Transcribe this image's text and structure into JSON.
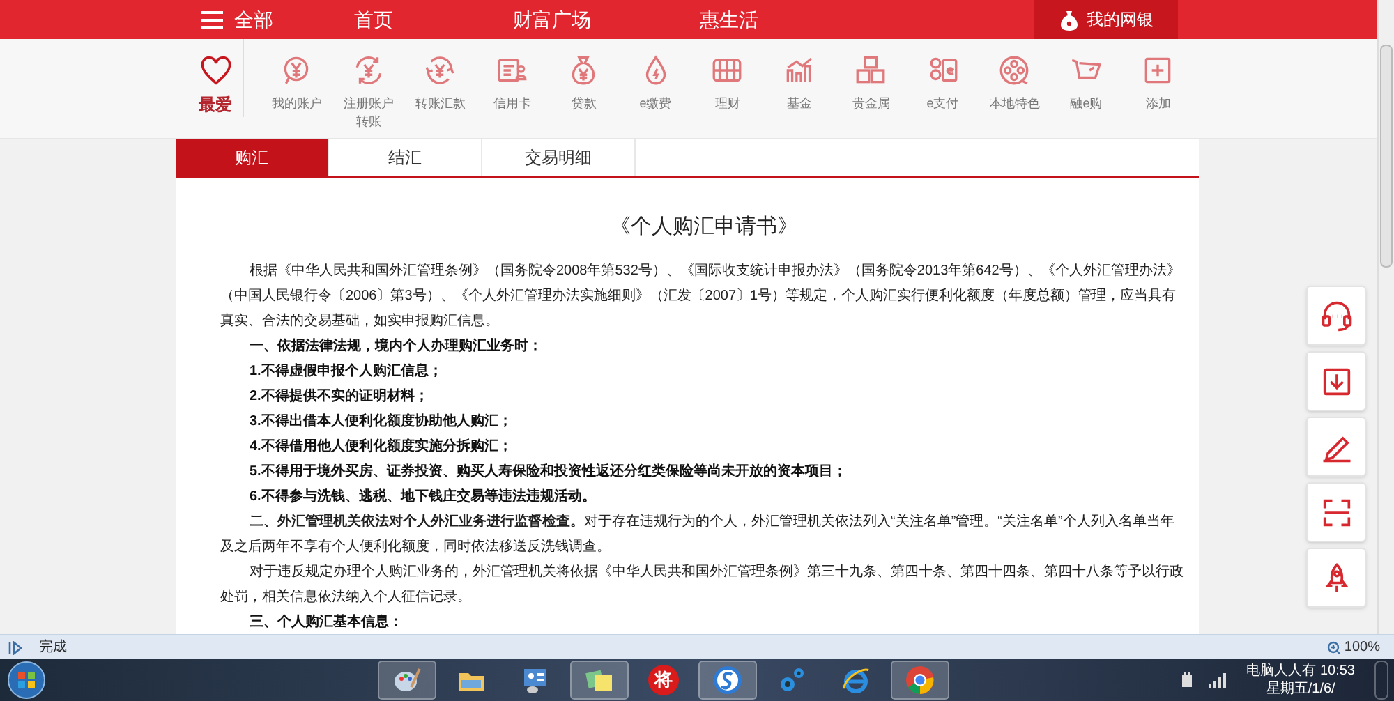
{
  "top_nav": {
    "menu_label": "全部",
    "items": [
      "首页",
      "财富广场",
      "惠生活"
    ],
    "account": "我的网银"
  },
  "shortcuts": [
    {
      "label": "最爱",
      "kind": "favorite"
    },
    {
      "label": "我的账户",
      "kind": "shortcut"
    },
    {
      "label": "注册账户转账",
      "kind": "shortcut"
    },
    {
      "label": "转账汇款",
      "kind": "shortcut"
    },
    {
      "label": "信用卡",
      "kind": "shortcut"
    },
    {
      "label": "贷款",
      "kind": "shortcut"
    },
    {
      "label": "e缴费",
      "kind": "shortcut"
    },
    {
      "label": "理财",
      "kind": "shortcut"
    },
    {
      "label": "基金",
      "kind": "shortcut"
    },
    {
      "label": "贵金属",
      "kind": "shortcut"
    },
    {
      "label": "e支付",
      "kind": "shortcut"
    },
    {
      "label": "本地特色",
      "kind": "shortcut"
    },
    {
      "label": "融e购",
      "kind": "shortcut"
    },
    {
      "label": "添加",
      "kind": "shortcut"
    }
  ],
  "tabs": [
    {
      "label": "购汇",
      "selected": true
    },
    {
      "label": "结汇",
      "selected": false
    },
    {
      "label": "交易明细",
      "selected": false
    }
  ],
  "document": {
    "title": "《个人购汇申请书》",
    "paragraphs": [
      {
        "kind": "body",
        "text": "根据《中华人民共和国外汇管理条例》（国务院令2008年第532号）、《国际收支统计申报办法》（国务院令2013年第642号）、《个人外汇管理办法》（中国人民银行令〔2006〕第3号）、《个人外汇管理办法实施细则》（汇发〔2007〕1号）等规定，个人购汇实行便利化额度（年度总额）管理，应当具有真实、合法的交易基础，如实申报购汇信息。"
      },
      {
        "kind": "bold",
        "text": "一、依据法律法规，境内个人办理购汇业务时："
      },
      {
        "kind": "bold",
        "text": "1.不得虚假申报个人购汇信息；"
      },
      {
        "kind": "bold",
        "text": "2.不得提供不实的证明材料；"
      },
      {
        "kind": "bold",
        "text": "3.不得出借本人便利化额度协助他人购汇；"
      },
      {
        "kind": "bold",
        "text": "4.不得借用他人便利化额度实施分拆购汇；"
      },
      {
        "kind": "bold",
        "text": "5.不得用于境外买房、证券投资、购买人寿保险和投资性返还分红类保险等尚未开放的资本项目；"
      },
      {
        "kind": "bold",
        "text": "6.不得参与洗钱、逃税、地下钱庄交易等违法违规活动。"
      },
      {
        "kind": "body",
        "text": "**二、外汇管理机关依法对个人外汇业务进行监督检查。**对于存在违规行为的个人，外汇管理机关依法列入“关注名单”管理。“关注名单”个人列入名单当年及之后两年不享有个人便利化额度，同时依法移送反洗钱调查。"
      },
      {
        "kind": "body",
        "text": "对于违反规定办理个人购汇业务的，外汇管理机关将依据《中华人民共和国外汇管理条例》第三十九条、第四十条、第四十四条、第四十八条等予以行政处罚，相关信息依法纳入个人征信记录。"
      },
      {
        "kind": "bold",
        "text": "三、个人购汇基本信息："
      }
    ]
  },
  "status_bar": {
    "text": "完成",
    "zoom": "100%"
  },
  "taskbar": {
    "badge_app": "将",
    "clock_time": "电脑人人有 10:53",
    "clock_date": "星期五/1/6/"
  }
}
